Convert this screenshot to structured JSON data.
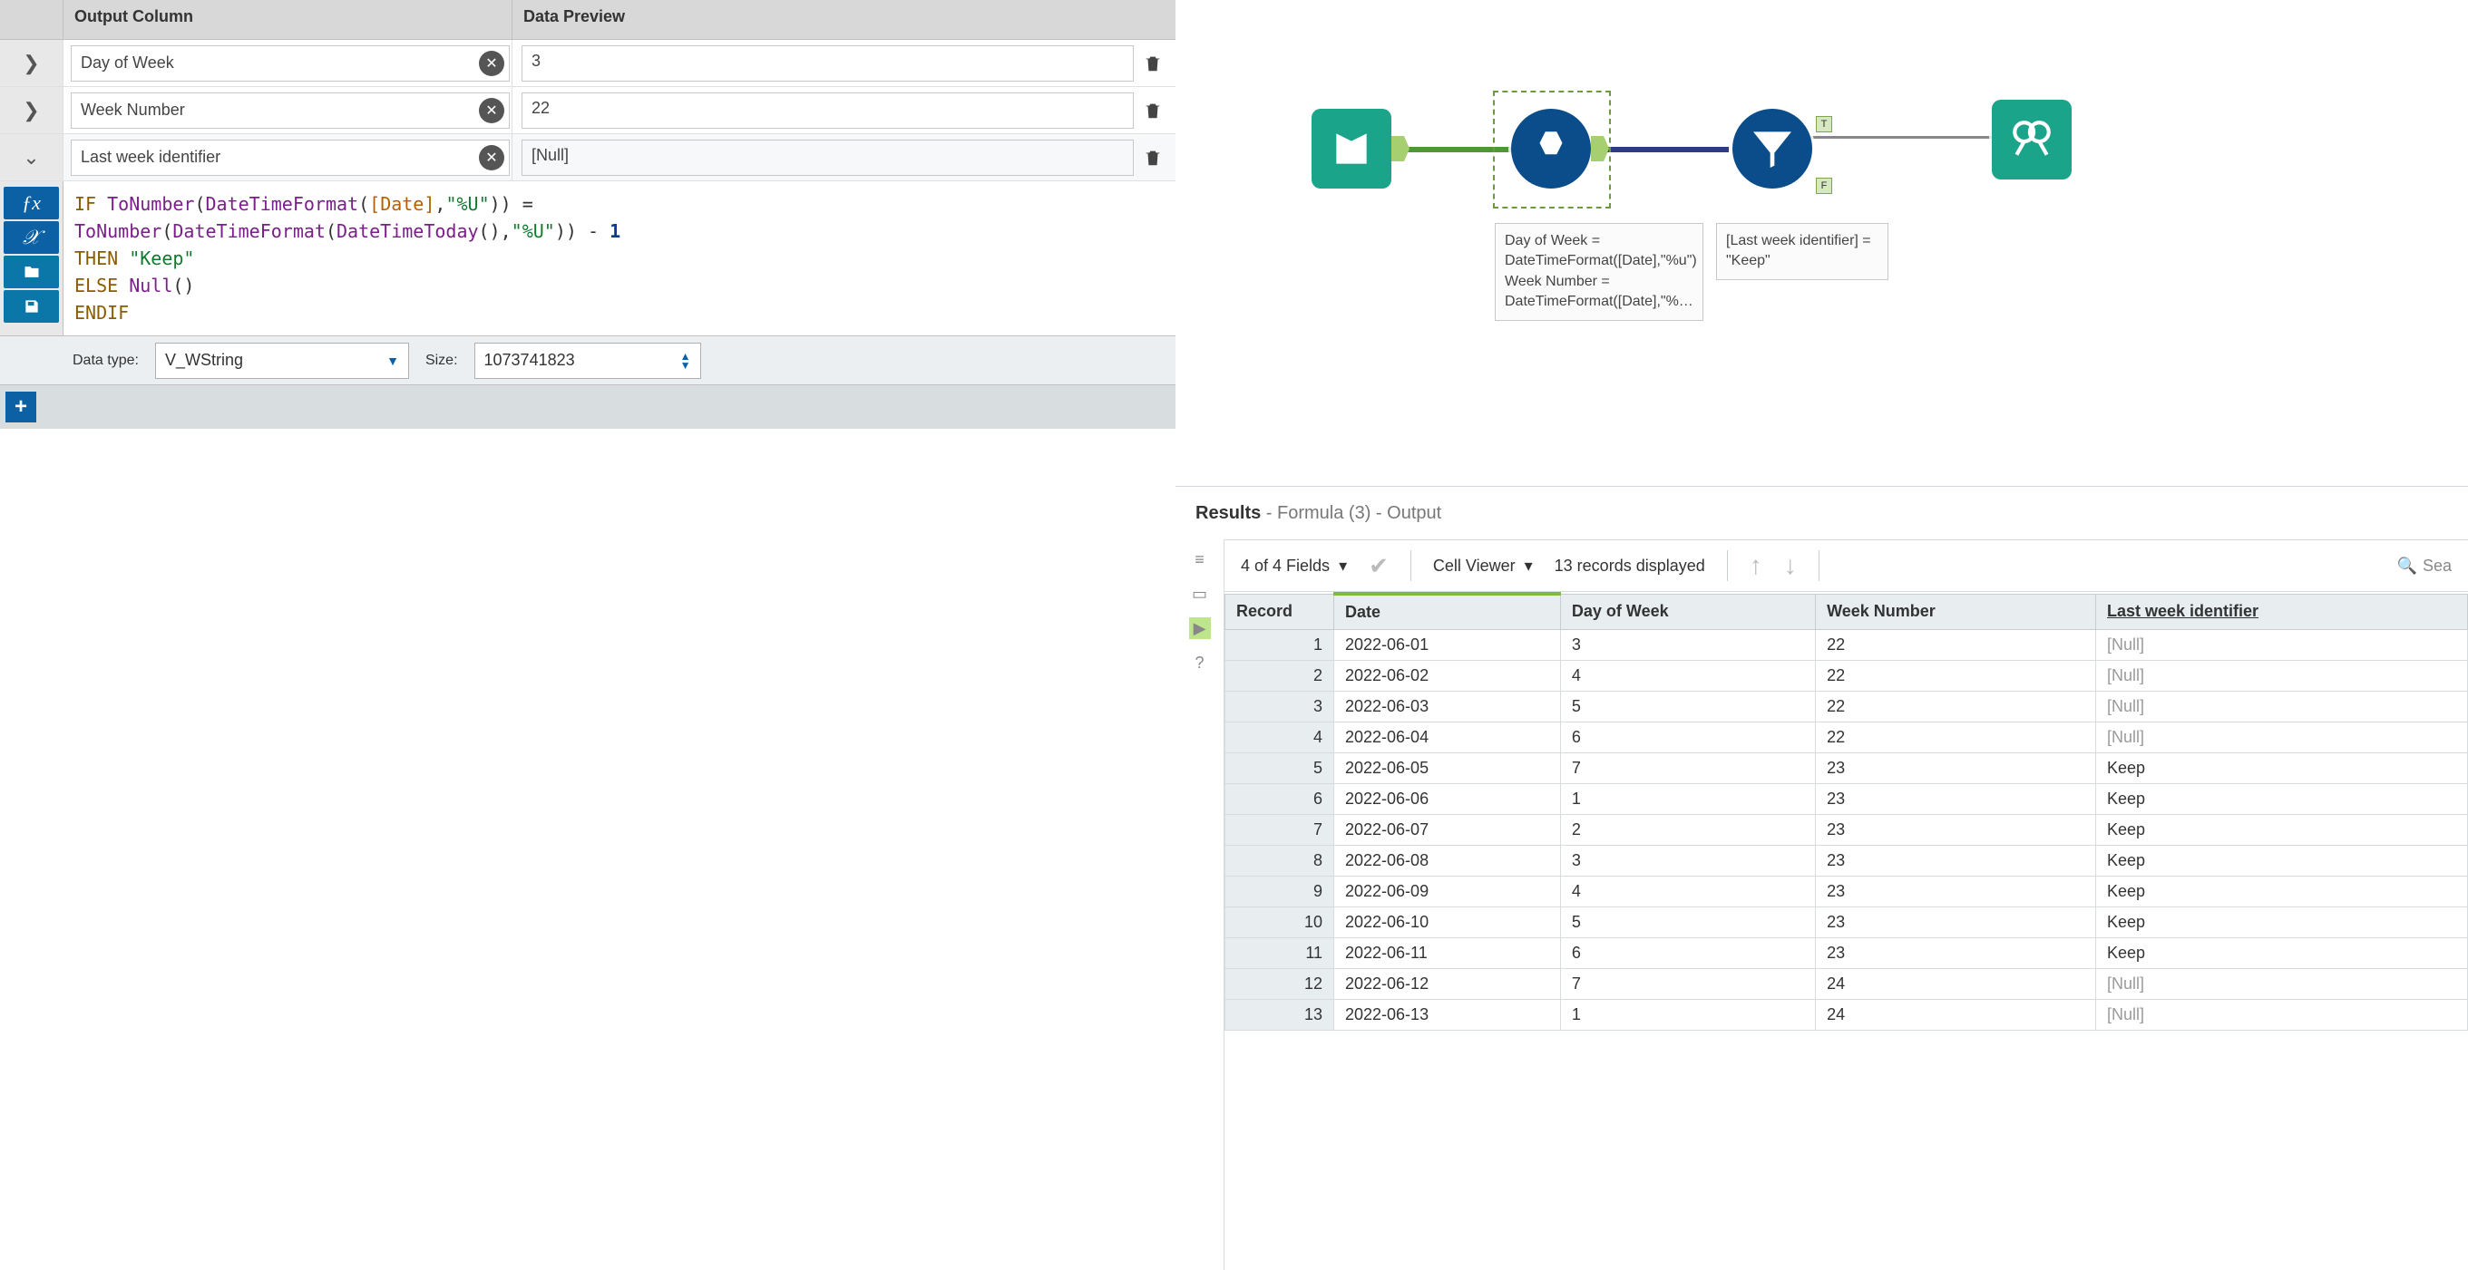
{
  "config": {
    "headers": {
      "output_col": "Output Column",
      "preview": "Data Preview"
    },
    "rows": [
      {
        "expanded": false,
        "name": "Day of Week",
        "preview": "3"
      },
      {
        "expanded": false,
        "name": "Week Number",
        "preview": "22"
      },
      {
        "expanded": true,
        "name": "Last week identifier",
        "preview": "[Null]"
      }
    ],
    "formula": {
      "line1_if": "IF",
      "line1_fn1": "ToNumber",
      "line1_fn2": "DateTimeFormat",
      "line1_field": "Date",
      "line1_fmt": "\"%U\"",
      "line2_fn1": "ToNumber",
      "line2_fn2": "DateTimeFormat",
      "line2_fn3": "DateTimeToday",
      "line2_fmt": "\"%U\"",
      "line2_minus": "1",
      "line3_then": "THEN",
      "line3_keep": "\"Keep\"",
      "line4_else": "ELSE",
      "line4_null": "Null",
      "line5": "ENDIF"
    },
    "dtype_label": "Data type:",
    "dtype_value": "V_WString",
    "size_label": "Size:",
    "size_value": "1073741823"
  },
  "canvas": {
    "formula_caption": "Day of Week = DateTimeFormat([Date],\"%u\")\nWeek Number = DateTimeFormat([Date],\"%…",
    "filter_caption": "[Last week identifier] = \"Keep\"",
    "anchor_t": "T",
    "anchor_f": "F"
  },
  "results": {
    "title": "Results",
    "subtitle": " - Formula (3) - Output",
    "fields_text": "4 of 4 Fields",
    "cellviewer": "Cell Viewer",
    "records_text": "13 records displayed",
    "search_placeholder": "Sea",
    "columns": [
      "Record",
      "Date",
      "Day of Week",
      "Week Number",
      "Last week identifier"
    ],
    "rows": [
      {
        "rec": "1",
        "date": "2022-06-01",
        "dow": "3",
        "wk": "22",
        "last": "[Null]"
      },
      {
        "rec": "2",
        "date": "2022-06-02",
        "dow": "4",
        "wk": "22",
        "last": "[Null]"
      },
      {
        "rec": "3",
        "date": "2022-06-03",
        "dow": "5",
        "wk": "22",
        "last": "[Null]"
      },
      {
        "rec": "4",
        "date": "2022-06-04",
        "dow": "6",
        "wk": "22",
        "last": "[Null]"
      },
      {
        "rec": "5",
        "date": "2022-06-05",
        "dow": "7",
        "wk": "23",
        "last": "Keep"
      },
      {
        "rec": "6",
        "date": "2022-06-06",
        "dow": "1",
        "wk": "23",
        "last": "Keep"
      },
      {
        "rec": "7",
        "date": "2022-06-07",
        "dow": "2",
        "wk": "23",
        "last": "Keep"
      },
      {
        "rec": "8",
        "date": "2022-06-08",
        "dow": "3",
        "wk": "23",
        "last": "Keep"
      },
      {
        "rec": "9",
        "date": "2022-06-09",
        "dow": "4",
        "wk": "23",
        "last": "Keep"
      },
      {
        "rec": "10",
        "date": "2022-06-10",
        "dow": "5",
        "wk": "23",
        "last": "Keep"
      },
      {
        "rec": "11",
        "date": "2022-06-11",
        "dow": "6",
        "wk": "23",
        "last": "Keep"
      },
      {
        "rec": "12",
        "date": "2022-06-12",
        "dow": "7",
        "wk": "24",
        "last": "[Null]"
      },
      {
        "rec": "13",
        "date": "2022-06-13",
        "dow": "1",
        "wk": "24",
        "last": "[Null]"
      }
    ]
  }
}
